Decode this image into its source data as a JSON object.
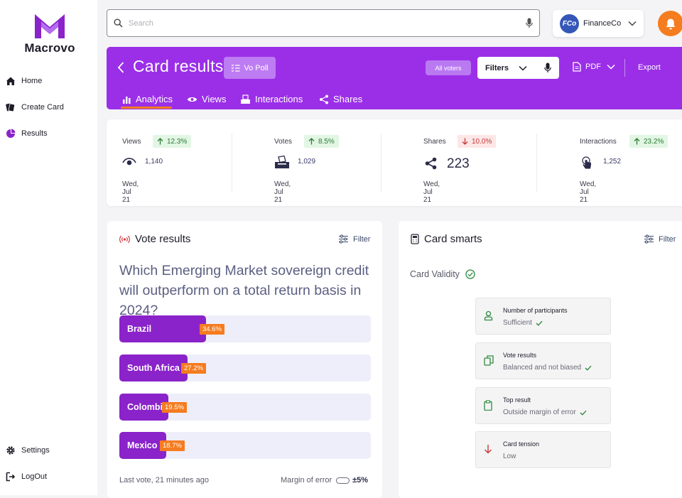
{
  "app": {
    "brand": "Macrovo"
  },
  "sidebar": {
    "items": [
      {
        "label": "Home",
        "icon": "home-icon"
      },
      {
        "label": "Create Card",
        "icon": "cards-icon"
      },
      {
        "label": "Results",
        "icon": "pie-chart-icon"
      }
    ],
    "bottom_items": [
      {
        "label": "Settings",
        "icon": "gear-icon"
      },
      {
        "label": "LogOut",
        "icon": "logout-icon"
      }
    ]
  },
  "search": {
    "placeholder": "Search"
  },
  "company": {
    "badge": "FCo",
    "name": "FinanceCo"
  },
  "header": {
    "title": "Card results",
    "type_badge": "Vo Poll",
    "all_voters": "All voters",
    "filters_label": "Filters",
    "pdf_label": "PDF",
    "export_label": "Export",
    "tabs": [
      {
        "label": "Analytics",
        "icon": "bar-chart-icon",
        "active": true
      },
      {
        "label": "Views",
        "icon": "eye-icon",
        "active": false
      },
      {
        "label": "Interactions",
        "icon": "ballot-icon",
        "active": false
      },
      {
        "label": "Shares",
        "icon": "share-icon",
        "active": false
      }
    ]
  },
  "stats": [
    {
      "label": "Views",
      "change": "12.3%",
      "direction": "up",
      "value": "1,140",
      "date": "Wed, Jul 21",
      "icon": "eye-icon"
    },
    {
      "label": "Votes",
      "change": "8.5%",
      "direction": "up",
      "value": "1,029",
      "date": "Wed, Jul 21",
      "icon": "ballot-box-icon"
    },
    {
      "label": "Shares",
      "change": "10.0%",
      "direction": "down",
      "value": "223",
      "date": "Wed, Jul 21",
      "icon": "share-icon"
    },
    {
      "label": "Interactions",
      "change": "23.2%",
      "direction": "up",
      "value": "1,252",
      "date": "Wed, Jul 21",
      "icon": "touch-icon"
    }
  ],
  "vote_results": {
    "title": "Vote results",
    "filter_label": "Filter",
    "question": "Which Emerging Market sovereign credit will outperform on a total return basis in 2024?",
    "options": [
      {
        "label": "Brazil",
        "percent_text": "34.6%",
        "percent": 34.6
      },
      {
        "label": "South Africa",
        "percent_text": "27.2%",
        "percent": 27.2
      },
      {
        "label": "Colombia",
        "percent_text": "19.5%",
        "percent": 19.5
      },
      {
        "label": "Mexico",
        "percent_text": "18.7%",
        "percent": 18.7
      }
    ],
    "last_vote": "Last vote, 21 minutes ago",
    "margin_label": "Margin of error",
    "margin_value": "±5%"
  },
  "card_smarts": {
    "title": "Card smarts",
    "filter_label": "Filter",
    "validity_label": "Card Validity",
    "checks": [
      {
        "title": "Number of participants",
        "value": "Sufficient",
        "icon": "person-icon",
        "ok": true
      },
      {
        "title": "Vote results",
        "value": "Balanced and not biased",
        "icon": "clipboard-copy-icon",
        "ok": true
      },
      {
        "title": "Top result",
        "value": "Outside margin of error",
        "icon": "clipboard-icon",
        "ok": true
      },
      {
        "title": "Card tension",
        "value": "Low",
        "icon": "arrow-down-icon",
        "ok": false
      }
    ]
  },
  "colors": {
    "accent": "#9b2fe8",
    "bar": "#8a23c9",
    "badge": "#f57c1f",
    "up": "#2c7a35",
    "down": "#c43a3a"
  }
}
